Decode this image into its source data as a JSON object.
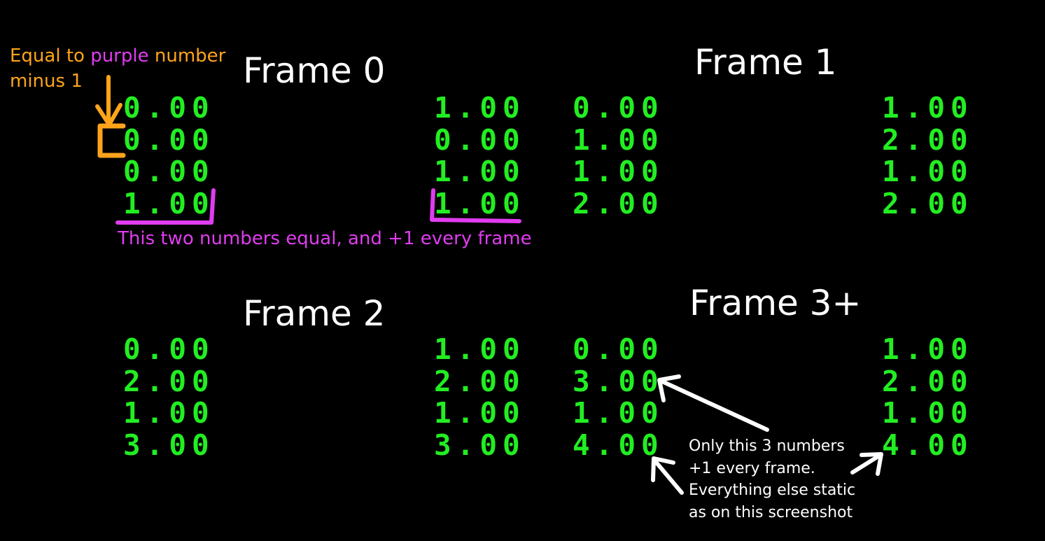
{
  "frames": [
    {
      "title": "Frame 0",
      "left": [
        "0.00",
        "0.00",
        "0.00",
        "1.00"
      ],
      "right": [
        "1.00",
        "0.00",
        "1.00",
        "1.00"
      ]
    },
    {
      "title": "Frame 1",
      "left": [
        "0.00",
        "1.00",
        "1.00",
        "2.00"
      ],
      "right": [
        "1.00",
        "2.00",
        "1.00",
        "2.00"
      ]
    },
    {
      "title": "Frame 2",
      "left": [
        "0.00",
        "2.00",
        "1.00",
        "3.00"
      ],
      "right": [
        "1.00",
        "2.00",
        "1.00",
        "3.00"
      ]
    },
    {
      "title": "Frame 3+",
      "left": [
        "0.00",
        "3.00",
        "1.00",
        "4.00"
      ],
      "right": [
        "1.00",
        "2.00",
        "1.00",
        "4.00"
      ]
    }
  ],
  "annotations": {
    "orange_line1_a": "Equal to ",
    "orange_line1_b": "purple",
    "orange_line1_c": " number",
    "orange_line2": "minus 1",
    "magenta": "This two numbers equal, and +1 every frame",
    "white_lines": [
      "Only this 3 numbers",
      "+1 every frame.",
      "Everything else static",
      "as on this screenshot"
    ]
  },
  "colors": {
    "digits": "#22ee22",
    "orange": "#ffa41a",
    "magenta": "#e03cf0",
    "white": "#ffffff",
    "background": "#000000"
  }
}
